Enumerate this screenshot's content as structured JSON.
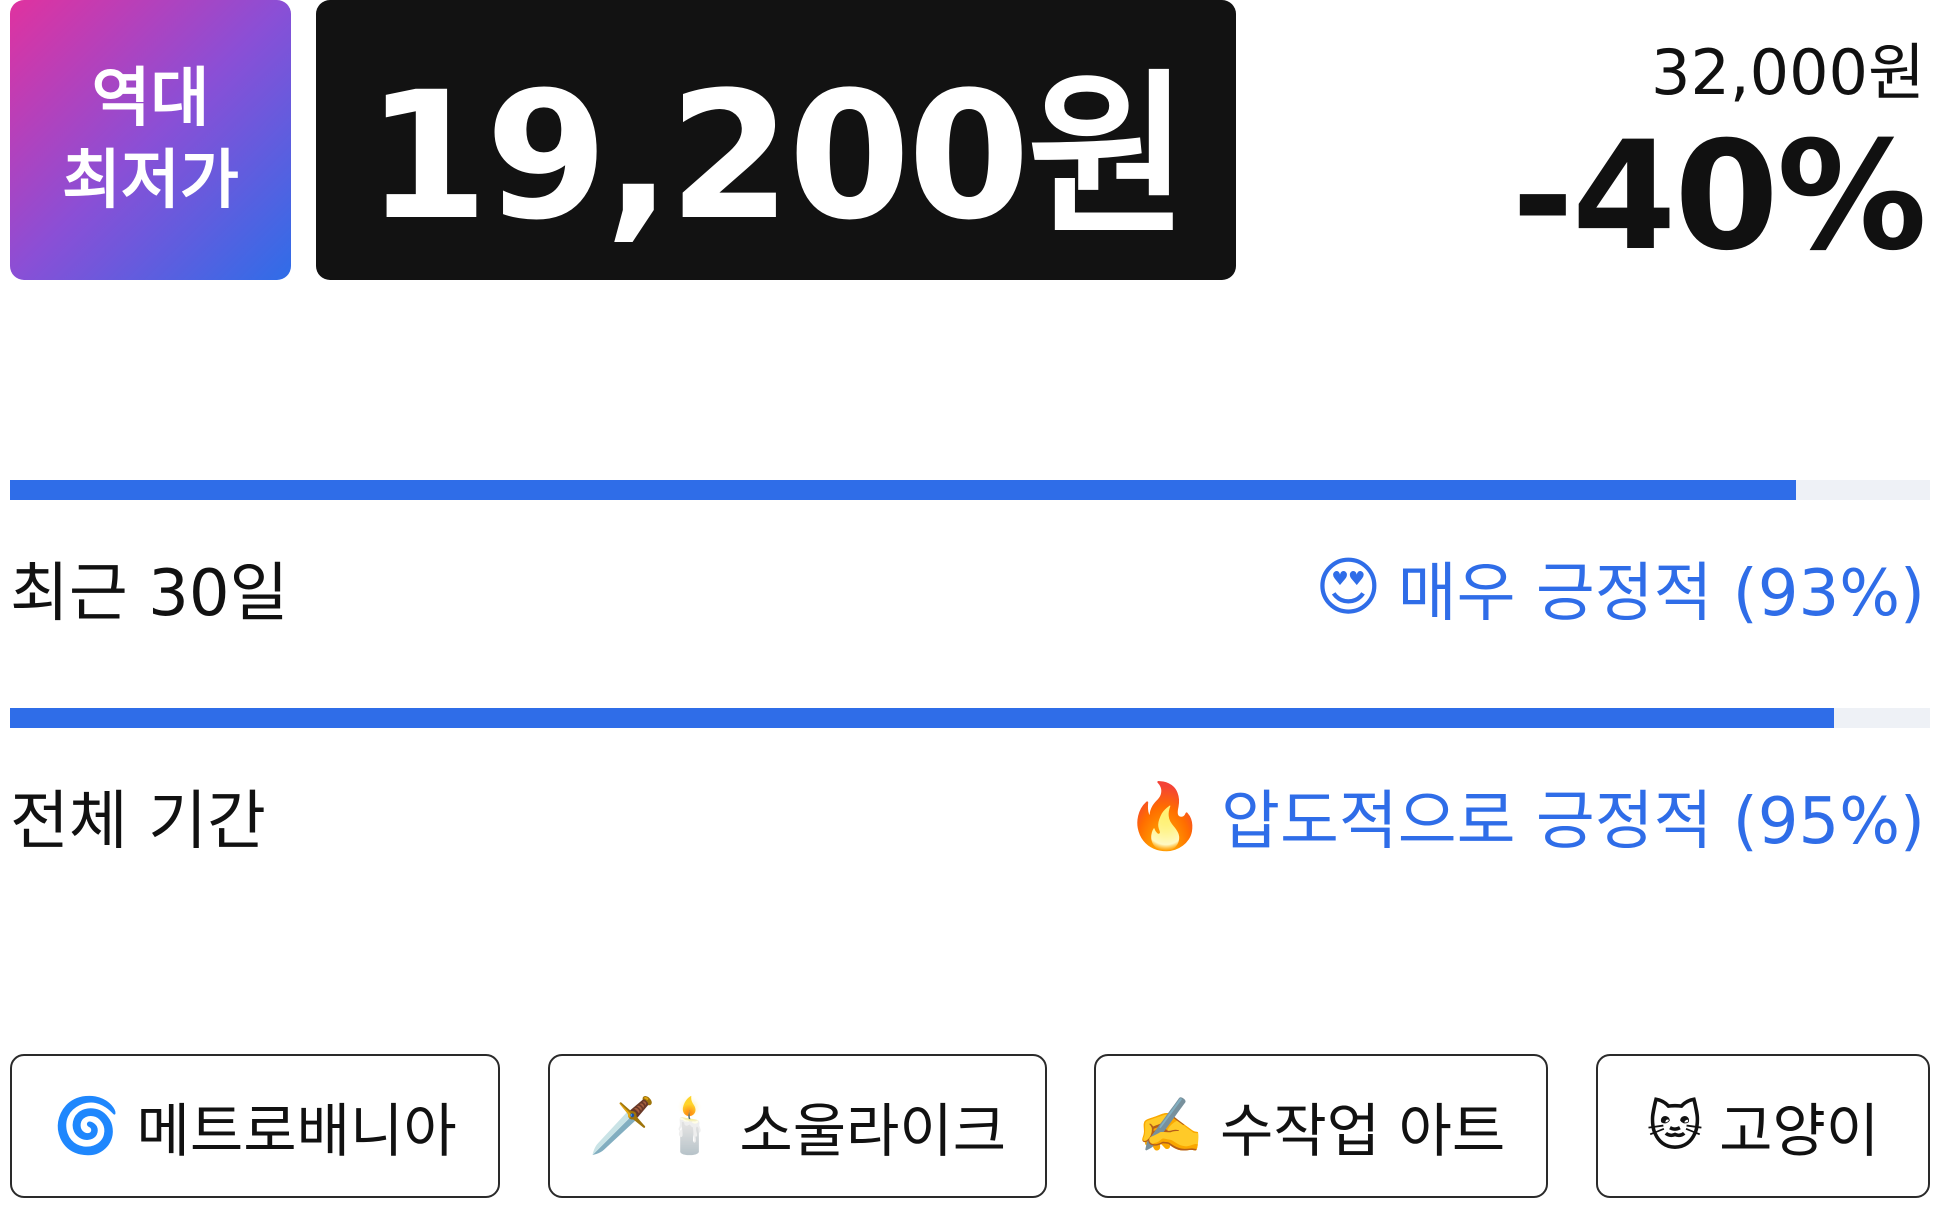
{
  "badge": {
    "line1": "역대",
    "line2": "최저가"
  },
  "price": {
    "sale": "19,200원",
    "original": "32,000원",
    "discount": "-40%"
  },
  "reviews": [
    {
      "label": "최근 30일",
      "emoji": "😍",
      "summary": "매우 긍정적 (93%)",
      "percent": 93
    },
    {
      "label": "전체 기간",
      "emoji": "🔥",
      "summary": "압도적으로 긍정적 (95%)",
      "percent": 95
    }
  ],
  "tags": [
    {
      "icon": "🌀",
      "icon_name": "cyclone-icon",
      "label": "메트로배니아"
    },
    {
      "icon": "🗡️🕯️",
      "icon_name": "dagger-candle-icon",
      "label": "소울라이크"
    },
    {
      "icon": "✍️",
      "icon_name": "writing-hand-icon",
      "label": "수작업 아트"
    },
    {
      "icon": "🐱",
      "icon_name": "cat-face-icon",
      "label": "고양이"
    }
  ],
  "colors": {
    "accent": "#2f6de8",
    "badge_gradient_start": "#e0329f",
    "badge_gradient_end": "#2f6de8",
    "price_box": "#121212",
    "bar_track": "#eef1f6"
  }
}
